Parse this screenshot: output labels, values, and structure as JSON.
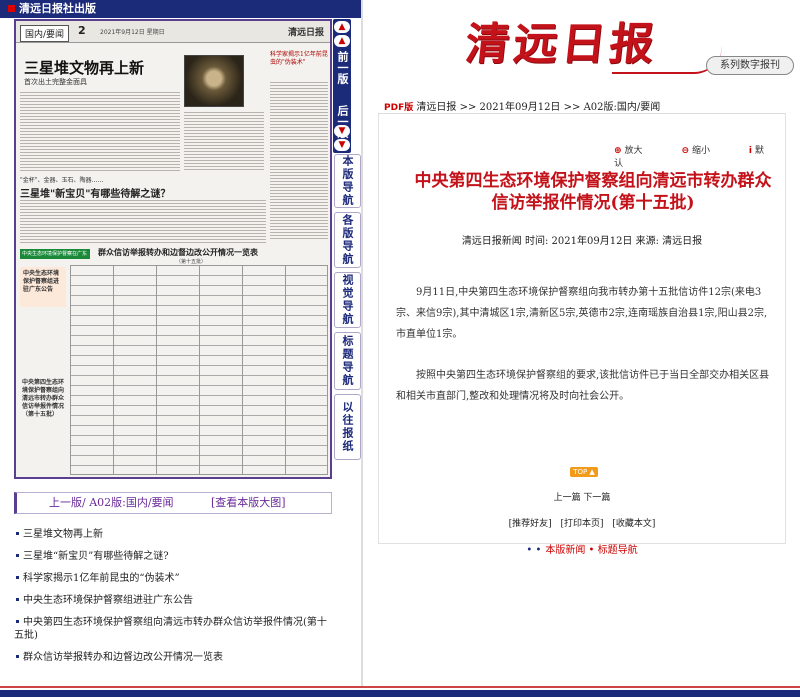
{
  "header": {
    "publisher": "清远日报社出版"
  },
  "thumbnail": {
    "section": "国内/要闻",
    "page_no": "2",
    "date": "2021年9月12日  星期日",
    "logo": "清远日报",
    "headline": "三星堆文物再上新",
    "subheadline": "首次出土完整金面具",
    "side_title": "科学家揭示1亿年前昆虫的\"伪装术\"",
    "q_kicker": "\"金杯\"、金器、玉石、陶器……",
    "q_title": "三星堆\"新宝贝\"有哪些待解之谜？",
    "banner": "中央生态环境保护督察在广东",
    "table_title": "群众信访举报转办和边督边改公开情况一览表",
    "table_sub": "（第十五批）",
    "box1": "中央生态环境保护督察组进驻广东公告",
    "box2": "中央第四生态环境保护督察组向清远市转办群众信访举报件情况（第十五批）"
  },
  "vertical_nav": {
    "arrows": [
      "▲",
      "▲",
      "▼",
      "▼"
    ],
    "prev_label": "前一版",
    "next_label": "后一版",
    "buttons": [
      "本版导航",
      "各版导航",
      "视觉导航",
      "标题导航",
      "以往报纸"
    ]
  },
  "page_nav": {
    "prev": "上一版/ A02版:国内/要闻",
    "view_full": "[查看本版大图]"
  },
  "article_list": [
    "三星堆文物再上新",
    "三星堆“新宝贝”有哪些待解之谜?",
    "科学家揭示1亿年前昆虫的“伪装术”",
    "中央生态环境保护督察组进驻广东公告",
    "中央第四生态环境保护督察组向清远市转办群众信访举报件情况(第十五批)",
    "群众信访举报转办和边督边改公开情况一览表"
  ],
  "masthead": {
    "logo": "清远日报",
    "digital_label": "系列数字报刊"
  },
  "breadcrumbs": {
    "pdf": "PDF版",
    "paper": "清远日报",
    "date": "2021年09月12日",
    "page": "A02版:国内/要闻"
  },
  "tools": {
    "zoom_in": "放大",
    "zoom_out": "缩小",
    "default": "默认"
  },
  "article": {
    "title": "中央第四生态环境保护督察组向清远市转办群众信访举报件情况(第十五批)",
    "meta": "清远日报新闻 时间: 2021年09月12日 来源: 清远日报",
    "paragraphs": [
      "9月11日,中央第四生态环境保护督察组向我市转办第十五批信访件12宗(来电3宗、来信9宗),其中清城区1宗,清新区5宗,英德市2宗,连南瑶族自治县1宗,阳山县2宗,市直单位1宗。",
      "按照中央第四生态环境保护督察组的要求,该批信访件已于当日全部交办相关区县和相关市直部门,整改和处理情况将及时向社会公开。"
    ]
  },
  "top_button": "TOP ▲",
  "prev_next": "上一篇 下一篇",
  "actions": [
    "[推荐好友]",
    "[打印本页]",
    "[收藏本文]"
  ],
  "footer_nav": "本版新闻 • 标题导航",
  "colors": {
    "brand_red": "#c4121a",
    "nav_purple": "#1c2a7a"
  }
}
